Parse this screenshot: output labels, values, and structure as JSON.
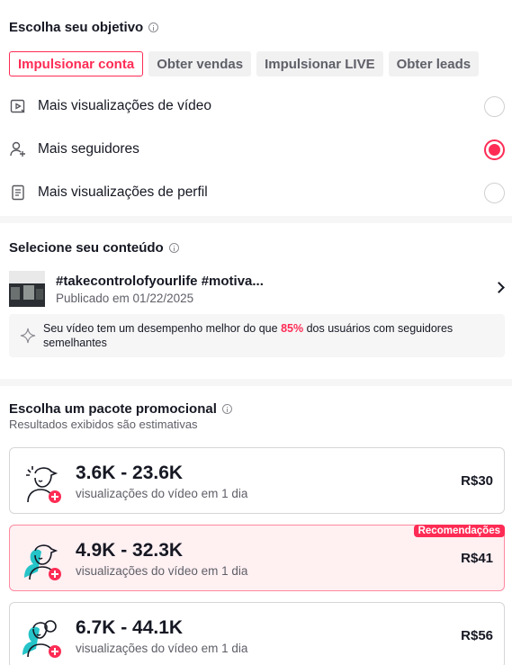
{
  "objective": {
    "title": "Escolha seu objetivo",
    "chips": [
      {
        "label": "Impulsionar conta",
        "active": true
      },
      {
        "label": "Obter vendas",
        "active": false
      },
      {
        "label": "Impulsionar LIVE",
        "active": false
      },
      {
        "label": "Obter leads",
        "active": false
      }
    ],
    "options": [
      {
        "label": "Mais visualizações de vídeo",
        "icon": "video-play-icon",
        "selected": false
      },
      {
        "label": "Mais seguidores",
        "icon": "add-user-icon",
        "selected": true
      },
      {
        "label": "Mais visualizações de perfil",
        "icon": "profile-doc-icon",
        "selected": false
      }
    ]
  },
  "content": {
    "title": "Selecione seu conteúdo",
    "video": {
      "title": "#takecontrolofyourlife #motiva...",
      "published": "Publicado em 01/22/2025"
    },
    "performance": {
      "prefix": "Seu vídeo tem um desempenho melhor do que ",
      "highlight": "85%",
      "suffix": " dos usuários com seguidores semelhantes"
    }
  },
  "packages": {
    "title": "Escolha um pacote promocional",
    "subtitle": "Resultados exibidos são estimativas",
    "items": [
      {
        "range": "3.6K - 23.6K",
        "desc": "visualizações do vídeo em 1 dia",
        "price": "R$30",
        "recommended": false
      },
      {
        "range": "4.9K - 32.3K",
        "desc": "visualizações do vídeo em 1 dia",
        "price": "R$41",
        "recommended": true,
        "badge": "Recomendações"
      },
      {
        "range": "6.7K - 44.1K",
        "desc": "visualizações do vídeo em 1 dia",
        "price": "R$56",
        "recommended": false
      }
    ]
  },
  "colors": {
    "accent": "#fe2c55",
    "teal": "#25c4c8",
    "rec_bg": "#fff0f2"
  }
}
